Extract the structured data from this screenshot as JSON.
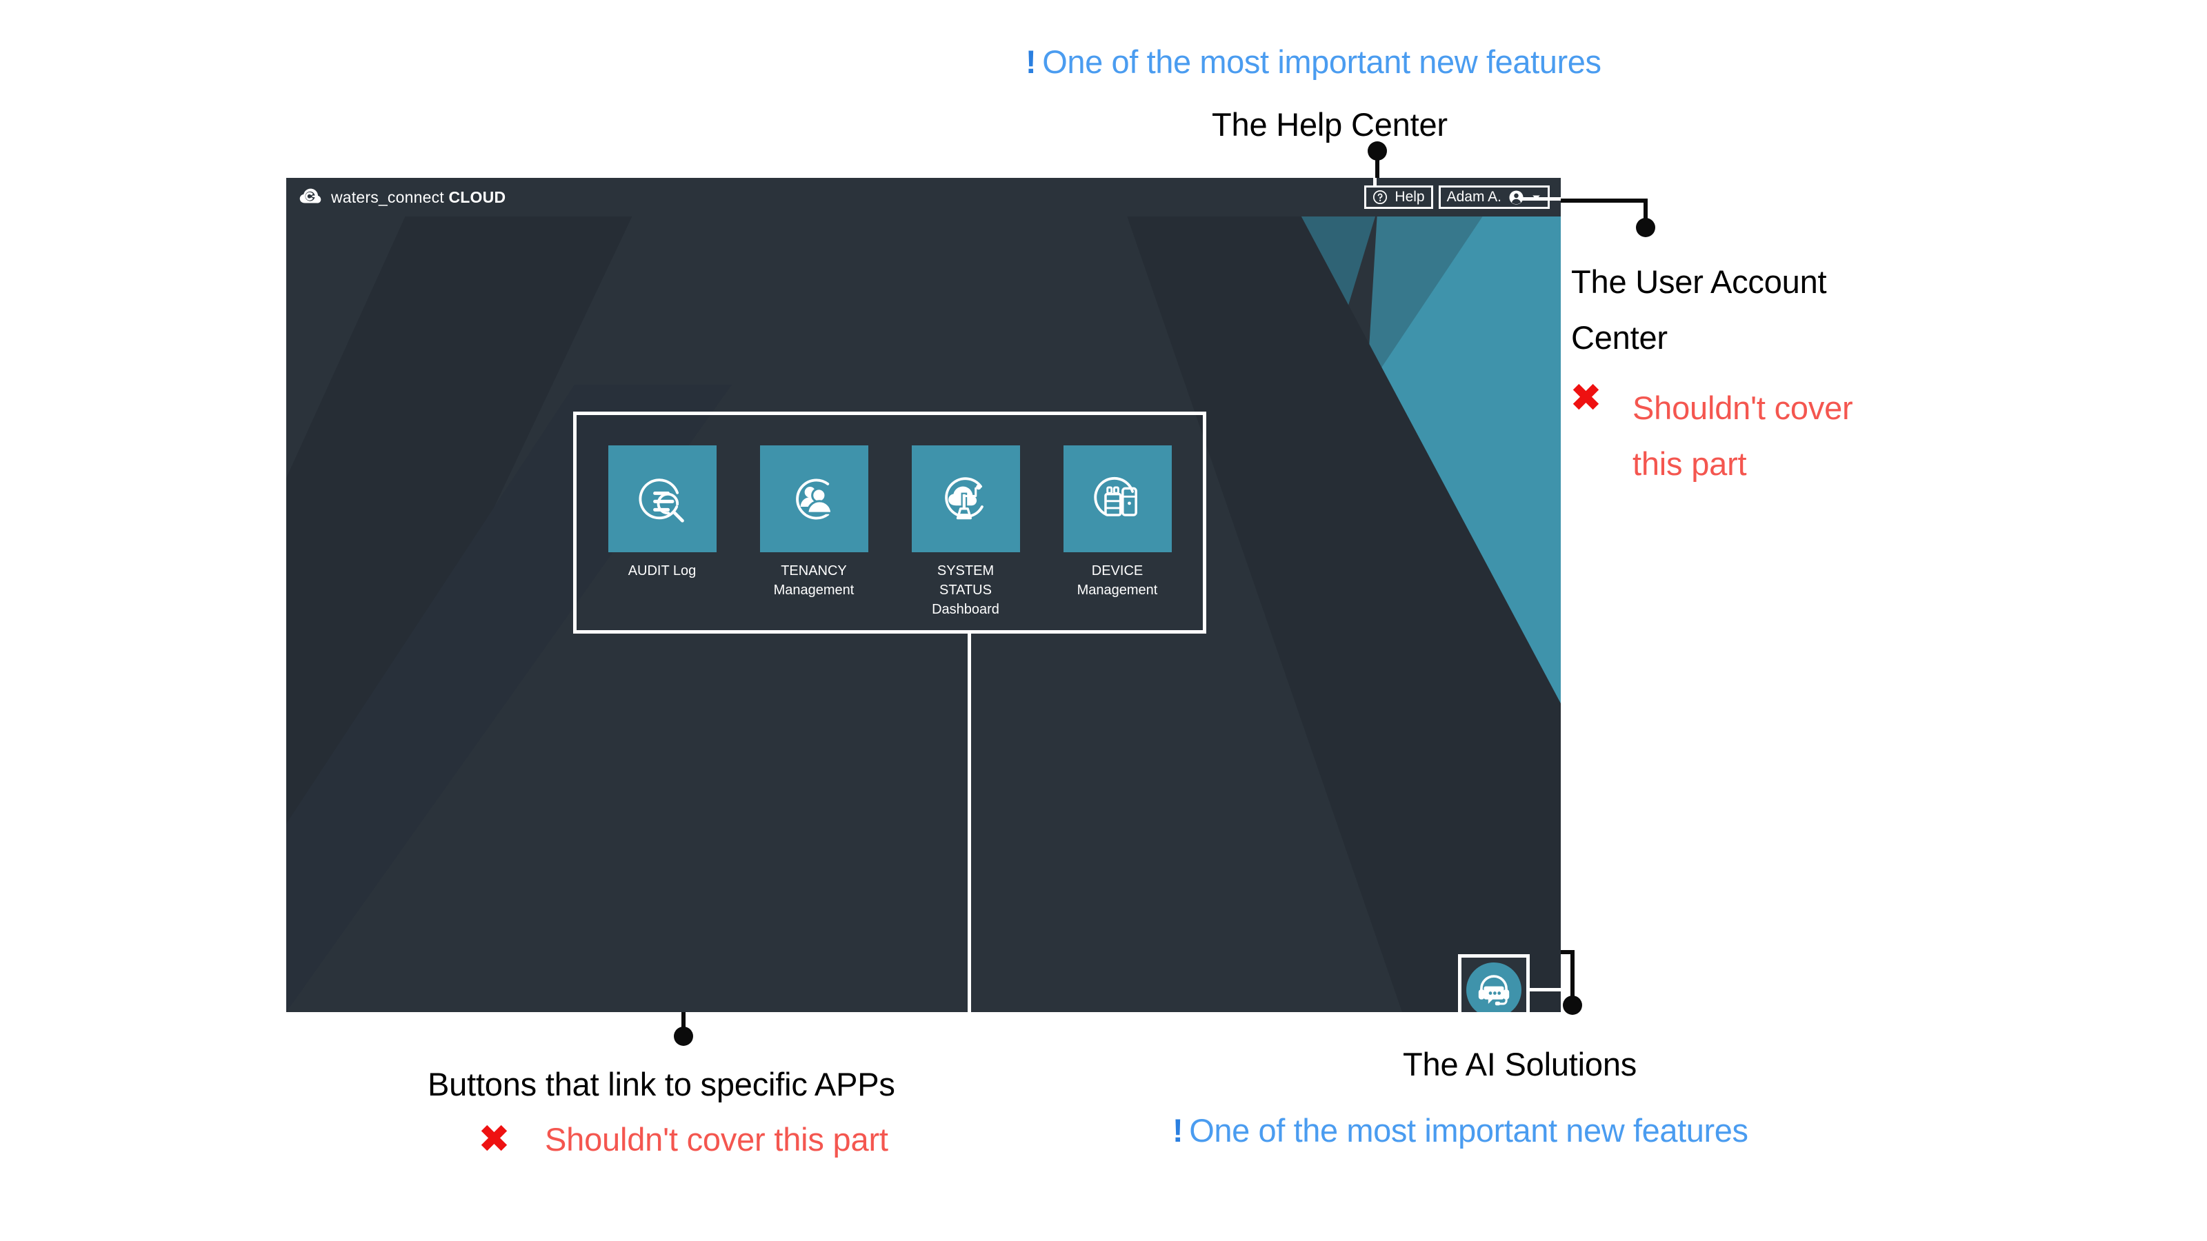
{
  "annotations": {
    "top_feature": {
      "bang": "!",
      "text": "One of the most important new features"
    },
    "help_center": "The Help Center",
    "user_center": "The User Account\nCenter",
    "user_warning": "Shouldn't cover\nthis part",
    "apps_caption": "Buttons that link to specific APPs",
    "apps_warning": "Shouldn't cover this part",
    "ai_caption": "The AI Solutions",
    "ai_feature": {
      "bang": "!",
      "text": "One of the most important new features"
    },
    "xmark": "✖"
  },
  "window": {
    "brand": {
      "name": "waters_connect",
      "product": "CLOUD",
      "logo_icon": "cloud-c-logo-icon"
    },
    "toolbar": {
      "help_label": "Help",
      "help_icon": "question-mark-circle-icon",
      "user_name": "Adam A.",
      "user_icon": "person-circle-icon",
      "user_chevron_icon": "chevron-down-icon"
    },
    "apps": [
      {
        "label": "AUDIT Log",
        "icon": "audit-log-search-icon"
      },
      {
        "label": "TENANCY\nManagement",
        "icon": "tenancy-users-icon"
      },
      {
        "label": "SYSTEM STATUS\nDashboard",
        "icon": "system-status-cloud-icon"
      },
      {
        "label": "DEVICE Management",
        "icon": "device-instrument-icon"
      }
    ],
    "ai_assistant": {
      "icon": "headset-chat-icon",
      "tooltip": "AI Solutions"
    }
  },
  "colors": {
    "window_bg": "#2b333b",
    "teal_accent": "#3f93ab",
    "teal_mid": "#37788c",
    "teal_deep": "#2f6375",
    "annotation_blue": "#4a9cf0",
    "annotation_red": "#f4564f",
    "annotation_black": "#000000"
  }
}
